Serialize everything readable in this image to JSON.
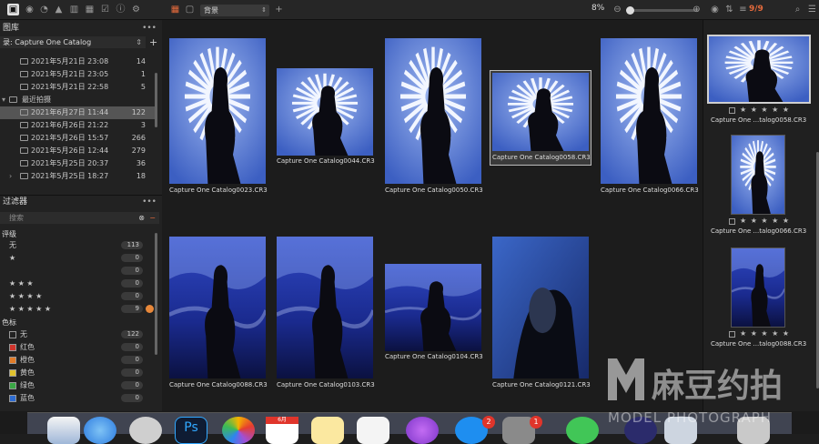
{
  "toolbar": {
    "view_select": "背景",
    "zoom": "8%",
    "count": "9/9"
  },
  "library": {
    "title": "图库",
    "catalog": "录: Capture One Catalog",
    "albums": [
      {
        "label": "2021年5月21日 23:08",
        "count": "14"
      },
      {
        "label": "2021年5月21日 23:05",
        "count": "1"
      },
      {
        "label": "2021年5月21日 22:58",
        "count": "5"
      },
      {
        "label": "最近拍摄",
        "count": ""
      },
      {
        "label": "2021年6月27日 11:44",
        "count": "122"
      },
      {
        "label": "2021年6月26日 21:22",
        "count": "3"
      },
      {
        "label": "2021年5月26日 15:57",
        "count": "266"
      },
      {
        "label": "2021年5月26日 12:44",
        "count": "279"
      },
      {
        "label": "2021年5月25日 20:37",
        "count": "36"
      },
      {
        "label": "2021年5月25日 18:27",
        "count": "18"
      }
    ]
  },
  "filters": {
    "title": "过滤器",
    "search_placeholder": "搜索",
    "rating_title": "评级",
    "ratings": [
      {
        "label": "无",
        "count": "113"
      },
      {
        "label": "★",
        "count": "0"
      },
      {
        "label": "",
        "count": "0"
      },
      {
        "label": "★ ★ ★",
        "count": "0"
      },
      {
        "label": "★ ★ ★ ★",
        "count": "0"
      },
      {
        "label": "★ ★ ★ ★ ★",
        "count": "9"
      }
    ],
    "color_title": "色标",
    "colors": [
      {
        "label": "无",
        "count": "122",
        "color": "#222222"
      },
      {
        "label": "红色",
        "count": "0",
        "color": "#d0342c"
      },
      {
        "label": "橙色",
        "count": "0",
        "color": "#e07b28"
      },
      {
        "label": "黄色",
        "count": "0",
        "color": "#e0c22e"
      },
      {
        "label": "绿色",
        "count": "0",
        "color": "#3aa845"
      },
      {
        "label": "蓝色",
        "count": "0",
        "color": "#2d6bd0"
      }
    ]
  },
  "browser": {
    "thumbs": [
      {
        "name": "Capture One Catalog0023.CR3"
      },
      {
        "name": "Capture One Catalog0044.CR3"
      },
      {
        "name": "Capture One Catalog0050.CR3"
      },
      {
        "name": "Capture One Catalog0058.CR3"
      },
      {
        "name": "Capture One Catalog0066.CR3"
      },
      {
        "name": "Capture One Catalog0088.CR3"
      },
      {
        "name": "Capture One Catalog0103.CR3"
      },
      {
        "name": "Capture One Catalog0104.CR3"
      },
      {
        "name": "Capture One Catalog0121.CR3"
      }
    ]
  },
  "filmstrip": {
    "items": [
      {
        "name": "Capture One ...talog0058.CR3",
        "stars": "★ ★ ★ ★ ★"
      },
      {
        "name": "Capture One ...talog0066.CR3",
        "stars": "★ ★ ★ ★ ★"
      },
      {
        "name": "Capture One ...talog0088.CR3",
        "stars": "★ ★ ★ ★ ★"
      }
    ]
  },
  "dock": {
    "badges": [
      "2",
      "1"
    ],
    "calendar_month": "6月"
  },
  "watermark": {
    "brand": "麻豆约拍",
    "sub": "MODEL PHOTOGRAPH"
  }
}
